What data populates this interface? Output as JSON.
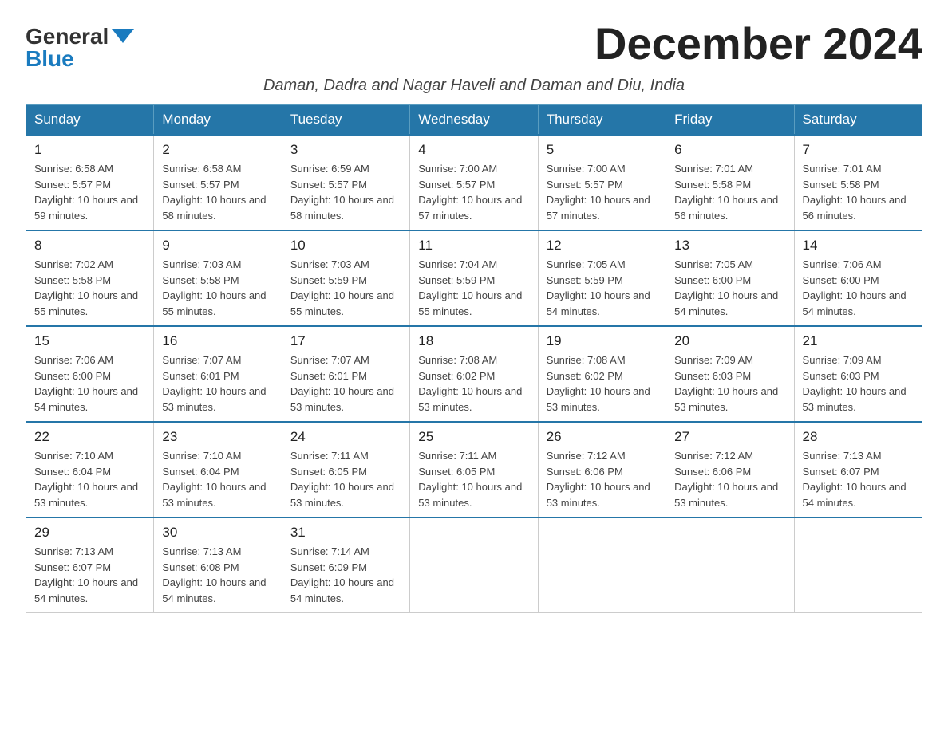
{
  "logo": {
    "general": "General",
    "blue": "Blue"
  },
  "title": "December 2024",
  "subtitle": "Daman, Dadra and Nagar Haveli and Daman and Diu, India",
  "days_of_week": [
    "Sunday",
    "Monday",
    "Tuesday",
    "Wednesday",
    "Thursday",
    "Friday",
    "Saturday"
  ],
  "weeks": [
    [
      {
        "day": "1",
        "sunrise": "6:58 AM",
        "sunset": "5:57 PM",
        "daylight": "10 hours and 59 minutes."
      },
      {
        "day": "2",
        "sunrise": "6:58 AM",
        "sunset": "5:57 PM",
        "daylight": "10 hours and 58 minutes."
      },
      {
        "day": "3",
        "sunrise": "6:59 AM",
        "sunset": "5:57 PM",
        "daylight": "10 hours and 58 minutes."
      },
      {
        "day": "4",
        "sunrise": "7:00 AM",
        "sunset": "5:57 PM",
        "daylight": "10 hours and 57 minutes."
      },
      {
        "day": "5",
        "sunrise": "7:00 AM",
        "sunset": "5:57 PM",
        "daylight": "10 hours and 57 minutes."
      },
      {
        "day": "6",
        "sunrise": "7:01 AM",
        "sunset": "5:58 PM",
        "daylight": "10 hours and 56 minutes."
      },
      {
        "day": "7",
        "sunrise": "7:01 AM",
        "sunset": "5:58 PM",
        "daylight": "10 hours and 56 minutes."
      }
    ],
    [
      {
        "day": "8",
        "sunrise": "7:02 AM",
        "sunset": "5:58 PM",
        "daylight": "10 hours and 55 minutes."
      },
      {
        "day": "9",
        "sunrise": "7:03 AM",
        "sunset": "5:58 PM",
        "daylight": "10 hours and 55 minutes."
      },
      {
        "day": "10",
        "sunrise": "7:03 AM",
        "sunset": "5:59 PM",
        "daylight": "10 hours and 55 minutes."
      },
      {
        "day": "11",
        "sunrise": "7:04 AM",
        "sunset": "5:59 PM",
        "daylight": "10 hours and 55 minutes."
      },
      {
        "day": "12",
        "sunrise": "7:05 AM",
        "sunset": "5:59 PM",
        "daylight": "10 hours and 54 minutes."
      },
      {
        "day": "13",
        "sunrise": "7:05 AM",
        "sunset": "6:00 PM",
        "daylight": "10 hours and 54 minutes."
      },
      {
        "day": "14",
        "sunrise": "7:06 AM",
        "sunset": "6:00 PM",
        "daylight": "10 hours and 54 minutes."
      }
    ],
    [
      {
        "day": "15",
        "sunrise": "7:06 AM",
        "sunset": "6:00 PM",
        "daylight": "10 hours and 54 minutes."
      },
      {
        "day": "16",
        "sunrise": "7:07 AM",
        "sunset": "6:01 PM",
        "daylight": "10 hours and 53 minutes."
      },
      {
        "day": "17",
        "sunrise": "7:07 AM",
        "sunset": "6:01 PM",
        "daylight": "10 hours and 53 minutes."
      },
      {
        "day": "18",
        "sunrise": "7:08 AM",
        "sunset": "6:02 PM",
        "daylight": "10 hours and 53 minutes."
      },
      {
        "day": "19",
        "sunrise": "7:08 AM",
        "sunset": "6:02 PM",
        "daylight": "10 hours and 53 minutes."
      },
      {
        "day": "20",
        "sunrise": "7:09 AM",
        "sunset": "6:03 PM",
        "daylight": "10 hours and 53 minutes."
      },
      {
        "day": "21",
        "sunrise": "7:09 AM",
        "sunset": "6:03 PM",
        "daylight": "10 hours and 53 minutes."
      }
    ],
    [
      {
        "day": "22",
        "sunrise": "7:10 AM",
        "sunset": "6:04 PM",
        "daylight": "10 hours and 53 minutes."
      },
      {
        "day": "23",
        "sunrise": "7:10 AM",
        "sunset": "6:04 PM",
        "daylight": "10 hours and 53 minutes."
      },
      {
        "day": "24",
        "sunrise": "7:11 AM",
        "sunset": "6:05 PM",
        "daylight": "10 hours and 53 minutes."
      },
      {
        "day": "25",
        "sunrise": "7:11 AM",
        "sunset": "6:05 PM",
        "daylight": "10 hours and 53 minutes."
      },
      {
        "day": "26",
        "sunrise": "7:12 AM",
        "sunset": "6:06 PM",
        "daylight": "10 hours and 53 minutes."
      },
      {
        "day": "27",
        "sunrise": "7:12 AM",
        "sunset": "6:06 PM",
        "daylight": "10 hours and 53 minutes."
      },
      {
        "day": "28",
        "sunrise": "7:13 AM",
        "sunset": "6:07 PM",
        "daylight": "10 hours and 54 minutes."
      }
    ],
    [
      {
        "day": "29",
        "sunrise": "7:13 AM",
        "sunset": "6:07 PM",
        "daylight": "10 hours and 54 minutes."
      },
      {
        "day": "30",
        "sunrise": "7:13 AM",
        "sunset": "6:08 PM",
        "daylight": "10 hours and 54 minutes."
      },
      {
        "day": "31",
        "sunrise": "7:14 AM",
        "sunset": "6:09 PM",
        "daylight": "10 hours and 54 minutes."
      },
      null,
      null,
      null,
      null
    ]
  ]
}
